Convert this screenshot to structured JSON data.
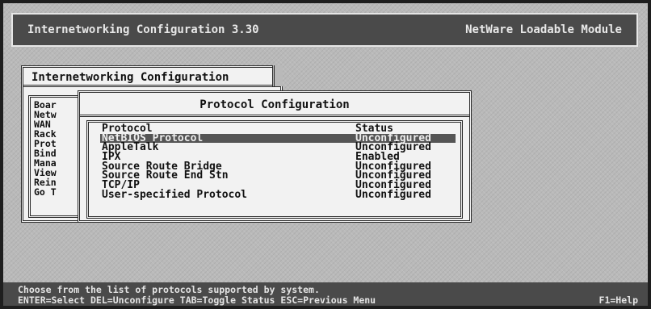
{
  "title_bar": {
    "left": "Internetworking Configuration  3.30",
    "right": "NetWare Loadable Module"
  },
  "internetworking_menu": {
    "title": "Internetworking Configuration",
    "items": [
      "Boar",
      "Netw",
      "WAN",
      "Rack",
      "Prot",
      "Bind",
      "Mana",
      "View",
      "Rein",
      "Go T"
    ]
  },
  "protocol_window": {
    "title": "Protocol Configuration",
    "columns": {
      "protocol": "Protocol",
      "status": "Status"
    },
    "rows": [
      {
        "protocol": "NetBIOS Protocol",
        "status": "Unconfigured",
        "selected": true
      },
      {
        "protocol": "AppleTalk",
        "status": "Unconfigured"
      },
      {
        "protocol": "IPX",
        "status": "Enabled"
      },
      {
        "protocol": "Source Route Bridge",
        "status": "Unconfigured"
      },
      {
        "protocol": "Source Route End Stn",
        "status": "Unconfigured"
      },
      {
        "protocol": "TCP/IP",
        "status": "Unconfigured"
      },
      {
        "protocol": "User-specified Protocol",
        "status": "Unconfigured"
      }
    ]
  },
  "status_bar": {
    "hint": "Choose from the list of protocols supported by system.",
    "keys": "ENTER=Select DEL=Unconfigure TAB=Toggle Status ESC=Previous Menu",
    "help": "F1=Help"
  }
}
